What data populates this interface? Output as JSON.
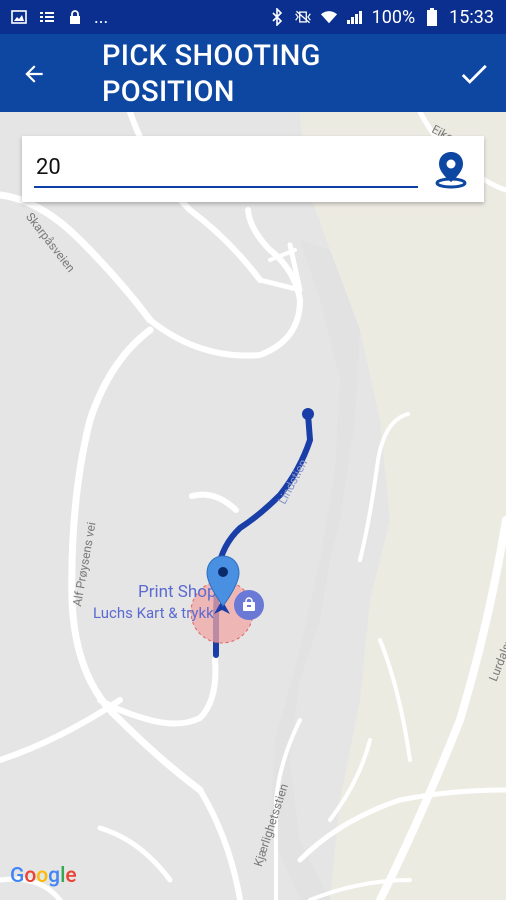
{
  "status_bar": {
    "battery": "100%",
    "time": "15:33",
    "dots": "..."
  },
  "app_bar": {
    "title": "PICK SHOOTING POSITION",
    "back_icon": "arrow-back-icon",
    "confirm_icon": "check-icon"
  },
  "search": {
    "value": "20",
    "icon": "location-pin-icon"
  },
  "map": {
    "labels": {
      "skarpasveien": "Skarpåsveien",
      "alf_proysens": "Alf Prøysens vei",
      "lurdalsveien": "Lurdalsveien",
      "kjaerlighetsstien": "Kjærlighetsstien",
      "trail": "Lindstien",
      "top_right": "Eiken"
    },
    "poi_title": "Print Shop",
    "poi_subtitle": "Luchs Kart & trykk"
  },
  "google": {
    "G": "G",
    "o1": "o",
    "o2": "o",
    "g": "g",
    "l": "l",
    "e": "e"
  },
  "colors": {
    "status_bar": "#0a2f8e",
    "app_bar": "#0d47a1",
    "track": "#1a3ea8",
    "pin": "#4a90e2"
  }
}
